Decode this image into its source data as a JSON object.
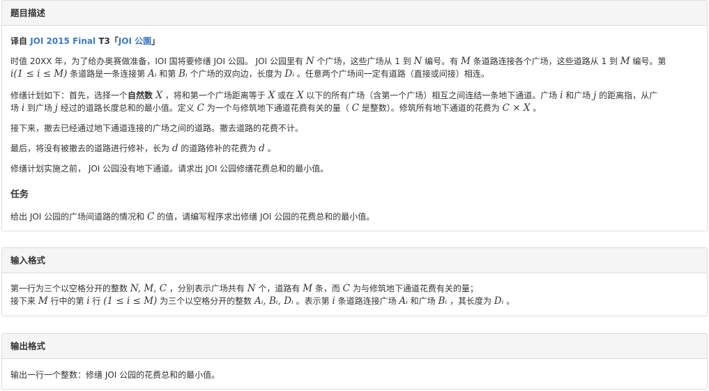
{
  "sections": {
    "description": {
      "title": "题目描述"
    },
    "input": {
      "title": "输入格式"
    },
    "output": {
      "title": "输出格式"
    }
  },
  "source": {
    "prefix": "译自 ",
    "contest": "JOI 2015 Final",
    "task": " T3「",
    "name": "JOI 公園",
    "suffix": "」"
  },
  "p1": {
    "a": "时值 20XX 年，为了给办奥赛做准备，IOI 国将要修缮 JOI 公园。 JOI 公园里有 ",
    "N": "N",
    "b": " 个广场，这些广场从 1 到 ",
    "N2": "N",
    "c": " 编号。有 ",
    "M": "M",
    "d": " 条道路连接各个广场，这些道路从 1 到 ",
    "M2": "M",
    "e": " 编号。第",
    "cond": "i(1 ≤ i ≤ M)",
    "f": " 条道路是一条连接第 ",
    "Ai": "Aᵢ",
    "g": " 和第 ",
    "Bi": "Bᵢ",
    "h": " 个广场的双向边，长度为 ",
    "Di": "Dᵢ",
    "k": " 。任意两个广场间一定有道路（直接或间接）相连。"
  },
  "p2": {
    "a": "修缮计划如下：首先，选择一个",
    "nat": "自然数",
    "X": " X",
    "b": " ，将和第一个广场距离等于 ",
    "X2": "X",
    "c": " 或在 ",
    "X3": "X",
    "d": " 以下的所有广场（含第一个广场）相互之间连结一条地下通道。广场 ",
    "i": "i",
    "e": " 和广场 ",
    "j": "j",
    "f": " 的距离指，从广",
    "g": "场 ",
    "i2": "i",
    "h": " 到广场 ",
    "j2": "j",
    "k": " 经过的道路长度总和的最小值。定义 ",
    "C": "C",
    "l": " 为一个与修筑地下通道花费有关的量（ ",
    "C2": "C",
    "m": " 是整数）。修筑所有地下通道的花费为 ",
    "CX": "C × X",
    "n": " 。"
  },
  "p3": "接下来，撤去已经通过地下通道连接的广场之间的道路。撤去道路的花费不计。",
  "p4": {
    "a": "最后，将没有被撤去的道路进行修补，长为 ",
    "d": "d",
    "b": " 的道路修补的花费为 ",
    "d2": "d",
    "c": " 。"
  },
  "p5": "修缮计划实施之前， JOI 公园没有地下通道。请求出 JOI 公园修缮花费总和的最小值。",
  "task_heading": "任务",
  "p6": {
    "a": "给出 JOI 公园的广场间道路的情况和 ",
    "C": "C",
    "b": " 的值，请编写程序求出修缮 JOI 公园的花费总和的最小值。"
  },
  "input_lines": {
    "l1": {
      "a": "第一行为三个以空格分开的整数 ",
      "vars": "N, M, C",
      "b": " ，分别表示广场共有 ",
      "N": "N",
      "c": " 个，道路有 ",
      "M": "M",
      "d": " 条，而 ",
      "C": "C",
      "e": " 为与修筑地下通道花费有关的量；"
    },
    "l2": {
      "a": "接下来 ",
      "M": "M",
      "b": " 行中的第 ",
      "i": "i",
      "c": " 行 ",
      "cond": "(1 ≤ i ≤ M)",
      "d": " 为三个以空格分开的整数 ",
      "vars": "Aᵢ, Bᵢ, Dᵢ",
      "e": " 。表示第 ",
      "i2": "i",
      "f": " 条道路连接广场 ",
      "Ai": "Aᵢ",
      "g": " 和广场 ",
      "Bi": "Bᵢ",
      "h": " ，其长度为 ",
      "Di": "Dᵢ",
      "k": " 。"
    }
  },
  "output_line": "输出一行一个整数：修缮 JOI 公园的花费总和的最小值。"
}
